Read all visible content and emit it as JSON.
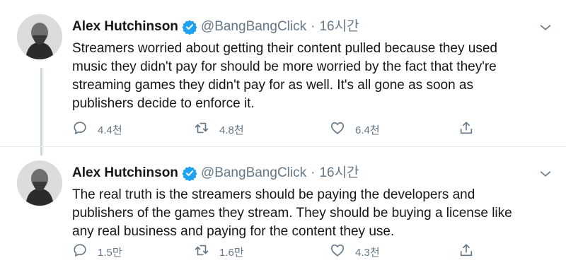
{
  "tweets": [
    {
      "author_name": "Alex Hutchinson",
      "handle": "@BangBangClick",
      "separator": "·",
      "time": "16시간",
      "text": "Streamers worried about getting their content pulled because they used\nmusic they didn't pay for should be more worried by the fact that they're\nstreaming games they didn't pay for as well. It's all gone as soon as\npublishers decide to enforce it.",
      "reply_count": "4.4천",
      "retweet_count": "4.8천",
      "like_count": "6.4천"
    },
    {
      "author_name": "Alex Hutchinson",
      "handle": "@BangBangClick",
      "separator": "·",
      "time": "16시간",
      "text": "The real truth is the streamers should be paying the developers and\npublishers of the games they stream. They should be buying a license like\nany real business and paying for the content they use.",
      "reply_count": "1.5만",
      "retweet_count": "1.6만",
      "like_count": "4.3천"
    }
  ],
  "icons": {
    "verified": "verified-badge-icon",
    "caret": "chevron-down-icon",
    "reply": "reply-icon",
    "retweet": "retweet-icon",
    "like": "heart-icon",
    "share": "share-icon"
  },
  "colors": {
    "accent": "#1da1f2",
    "text": "#14171a",
    "muted": "#657786",
    "thread_line": "#ccd6dd"
  }
}
